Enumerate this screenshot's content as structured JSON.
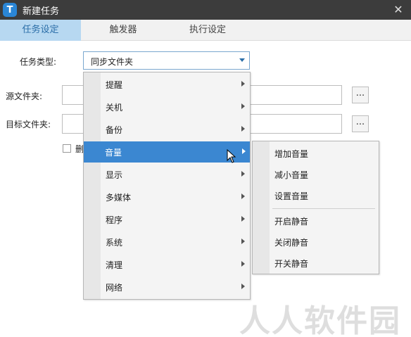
{
  "window": {
    "title": "新建任务",
    "logo_letter": "T",
    "close_glyph": "✕"
  },
  "tabs": [
    {
      "label": "任务设定",
      "active": true
    },
    {
      "label": "触发器",
      "active": false
    },
    {
      "label": "执行设定",
      "active": false
    }
  ],
  "form": {
    "task_type_label": "任务类型:",
    "task_type_value": "同步文件夹",
    "source_label": "源文件夹:",
    "source_value": "",
    "target_label": "目标文件夹:",
    "target_value": "",
    "browse_label": "...",
    "checkbox_label": "删"
  },
  "menu": {
    "items": [
      {
        "label": "提醒"
      },
      {
        "label": "关机"
      },
      {
        "label": "备份"
      },
      {
        "label": "音量",
        "highlighted": true
      },
      {
        "label": "显示"
      },
      {
        "label": "多媒体"
      },
      {
        "label": "程序"
      },
      {
        "label": "系统"
      },
      {
        "label": "清理"
      },
      {
        "label": "网络"
      }
    ]
  },
  "submenu": {
    "group1": [
      {
        "label": "增加音量"
      },
      {
        "label": "减小音量"
      },
      {
        "label": "设置音量"
      }
    ],
    "group2": [
      {
        "label": "开启静音"
      },
      {
        "label": "关闭静音"
      },
      {
        "label": "开关静音"
      }
    ]
  },
  "watermark": {
    "text": "人人软件园"
  },
  "colors": {
    "accent": "#3b87d1",
    "titlebar": "#3c3c3c",
    "tab_active": "#b7d8f1"
  }
}
